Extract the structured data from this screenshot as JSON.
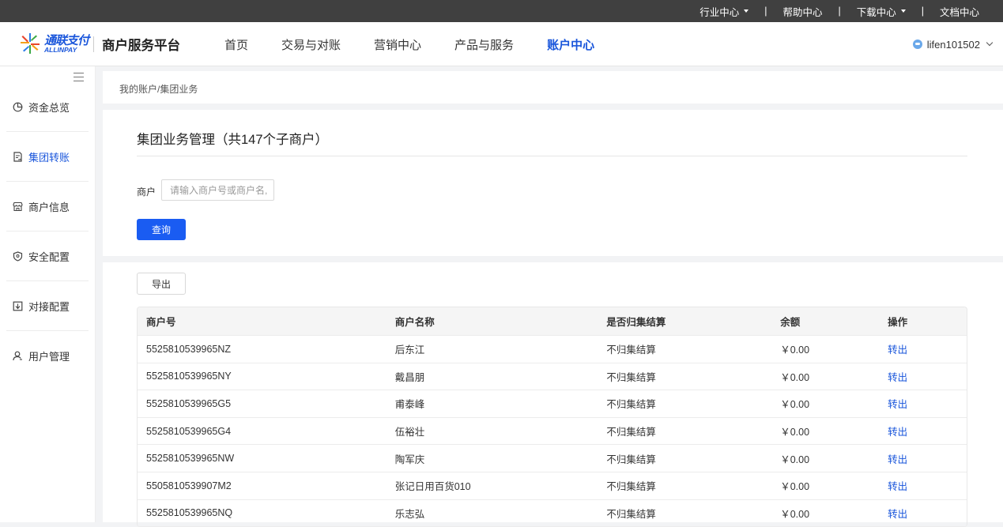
{
  "topbar": {
    "links": [
      {
        "label": "行业中心",
        "dropdown": true
      },
      {
        "label": "帮助中心",
        "dropdown": false
      },
      {
        "label": "下载中心",
        "dropdown": true
      },
      {
        "label": "文档中心",
        "dropdown": false
      }
    ],
    "separator": "|"
  },
  "header": {
    "logo_cn": "通联支付",
    "logo_en": "ALLINPAY",
    "platform_title": "商户服务平台",
    "nav": [
      "首页",
      "交易与对账",
      "营销中心",
      "产品与服务",
      "账户中心"
    ],
    "active_nav": "账户中心",
    "username": "lifen101502"
  },
  "sidebar": {
    "items": [
      {
        "label": "资金总览",
        "icon": "pie-chart-icon"
      },
      {
        "label": "集团转账",
        "icon": "transfer-doc-icon",
        "active": true
      },
      {
        "label": "商户信息",
        "icon": "store-icon"
      },
      {
        "label": "安全配置",
        "icon": "shield-icon"
      },
      {
        "label": "对接配置",
        "icon": "connect-icon"
      },
      {
        "label": "用户管理",
        "icon": "user-icon"
      }
    ]
  },
  "breadcrumb": "我的账户/集团业务",
  "page": {
    "title": "集团业务管理（共147个子商户）",
    "filter_label": "商户",
    "filter_placeholder": "请输入商户号或商户名,",
    "query_button": "查询",
    "export_button": "导出"
  },
  "table": {
    "headers": [
      "商户号",
      "商户名称",
      "是否归集结算",
      "余额",
      "操作"
    ],
    "rows": [
      {
        "id": "5525810539965NZ",
        "name": "后东江",
        "settle": "不归集结算",
        "balance": "￥0.00",
        "action": "转出"
      },
      {
        "id": "5525810539965NY",
        "name": "戴昌朋",
        "settle": "不归集结算",
        "balance": "￥0.00",
        "action": "转出"
      },
      {
        "id": "5525810539965G5",
        "name": "甫泰峰",
        "settle": "不归集结算",
        "balance": "￥0.00",
        "action": "转出"
      },
      {
        "id": "5525810539965G4",
        "name": "伍裕壮",
        "settle": "不归集结算",
        "balance": "￥0.00",
        "action": "转出"
      },
      {
        "id": "5525810539965NW",
        "name": "陶军庆",
        "settle": "不归集结算",
        "balance": "￥0.00",
        "action": "转出"
      },
      {
        "id": "5505810539907M2",
        "name": "张记日用百货010",
        "settle": "不归集结算",
        "balance": "￥0.00",
        "action": "转出"
      },
      {
        "id": "5525810539965NQ",
        "name": "乐志弘",
        "settle": "不归集结算",
        "balance": "￥0.00",
        "action": "转出"
      }
    ]
  },
  "colors": {
    "accent": "#1a56db",
    "primary_button": "#1a5cf2",
    "topbar_bg": "#404040"
  }
}
